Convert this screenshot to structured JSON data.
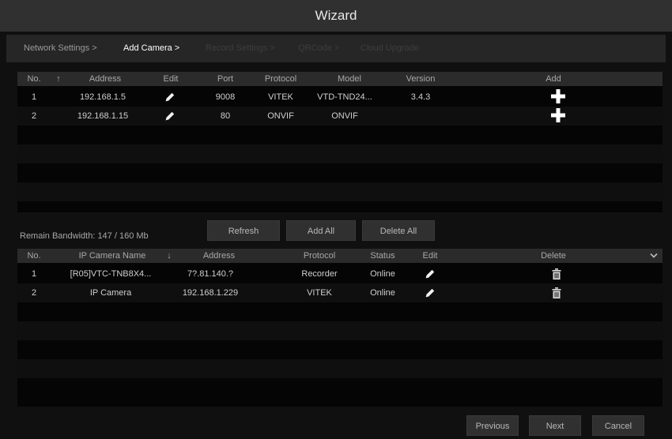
{
  "window": {
    "title": "Wizard"
  },
  "steps": [
    {
      "label": "Network Settings >",
      "state": "done"
    },
    {
      "label": "Add Camera >",
      "state": "active"
    },
    {
      "label": "Record Settings >",
      "state": "future"
    },
    {
      "label": "QRCode >",
      "state": "future"
    },
    {
      "label": "Cloud Upgrade",
      "state": "future"
    }
  ],
  "search_table": {
    "headers": {
      "no": "No.",
      "sort": "↑",
      "address": "Address",
      "edit": "Edit",
      "port": "Port",
      "protocol": "Protocol",
      "model": "Model",
      "version": "Version",
      "add": "Add"
    },
    "rows": [
      {
        "no": "1",
        "address": "192.168.1.5",
        "port": "9008",
        "protocol": "VITEK",
        "model": "VTD-TND24...",
        "version": "3.4.3"
      },
      {
        "no": "2",
        "address": "192.168.1.15",
        "port": "80",
        "protocol": "ONVIF",
        "model": "ONVIF",
        "version": ""
      }
    ]
  },
  "buttons": {
    "refresh": "Refresh",
    "add_all": "Add All",
    "delete_all": "Delete All",
    "previous": "Previous",
    "next": "Next",
    "cancel": "Cancel"
  },
  "bandwidth": {
    "label": "Remain Bandwidth: 147 / 160 Mb"
  },
  "camera_table": {
    "headers": {
      "no": "No.",
      "name": "IP Camera Name",
      "sort": "↓",
      "address": "Address",
      "protocol": "Protocol",
      "status": "Status",
      "edit": "Edit",
      "delete": "Delete"
    },
    "rows": [
      {
        "no": "1",
        "name": "[R05]VTC-TNB8X4...",
        "address": "7?.81.140.?",
        "protocol": "Recorder",
        "status": "Online"
      },
      {
        "no": "2",
        "name": "IP Camera",
        "address": "192.168.1.229",
        "protocol": "VITEK",
        "status": "Online"
      }
    ]
  },
  "icons": {
    "edit": "pencil-icon",
    "add": "plus-icon",
    "delete": "trash-icon",
    "dropdown": "chevron-down-icon"
  },
  "colors": {
    "titlebar": "#303030",
    "header": "#2b2b2b",
    "background": "#101010",
    "text": "#cfcfcf",
    "active_step": "#ffffff",
    "icon": "#ffffff"
  }
}
